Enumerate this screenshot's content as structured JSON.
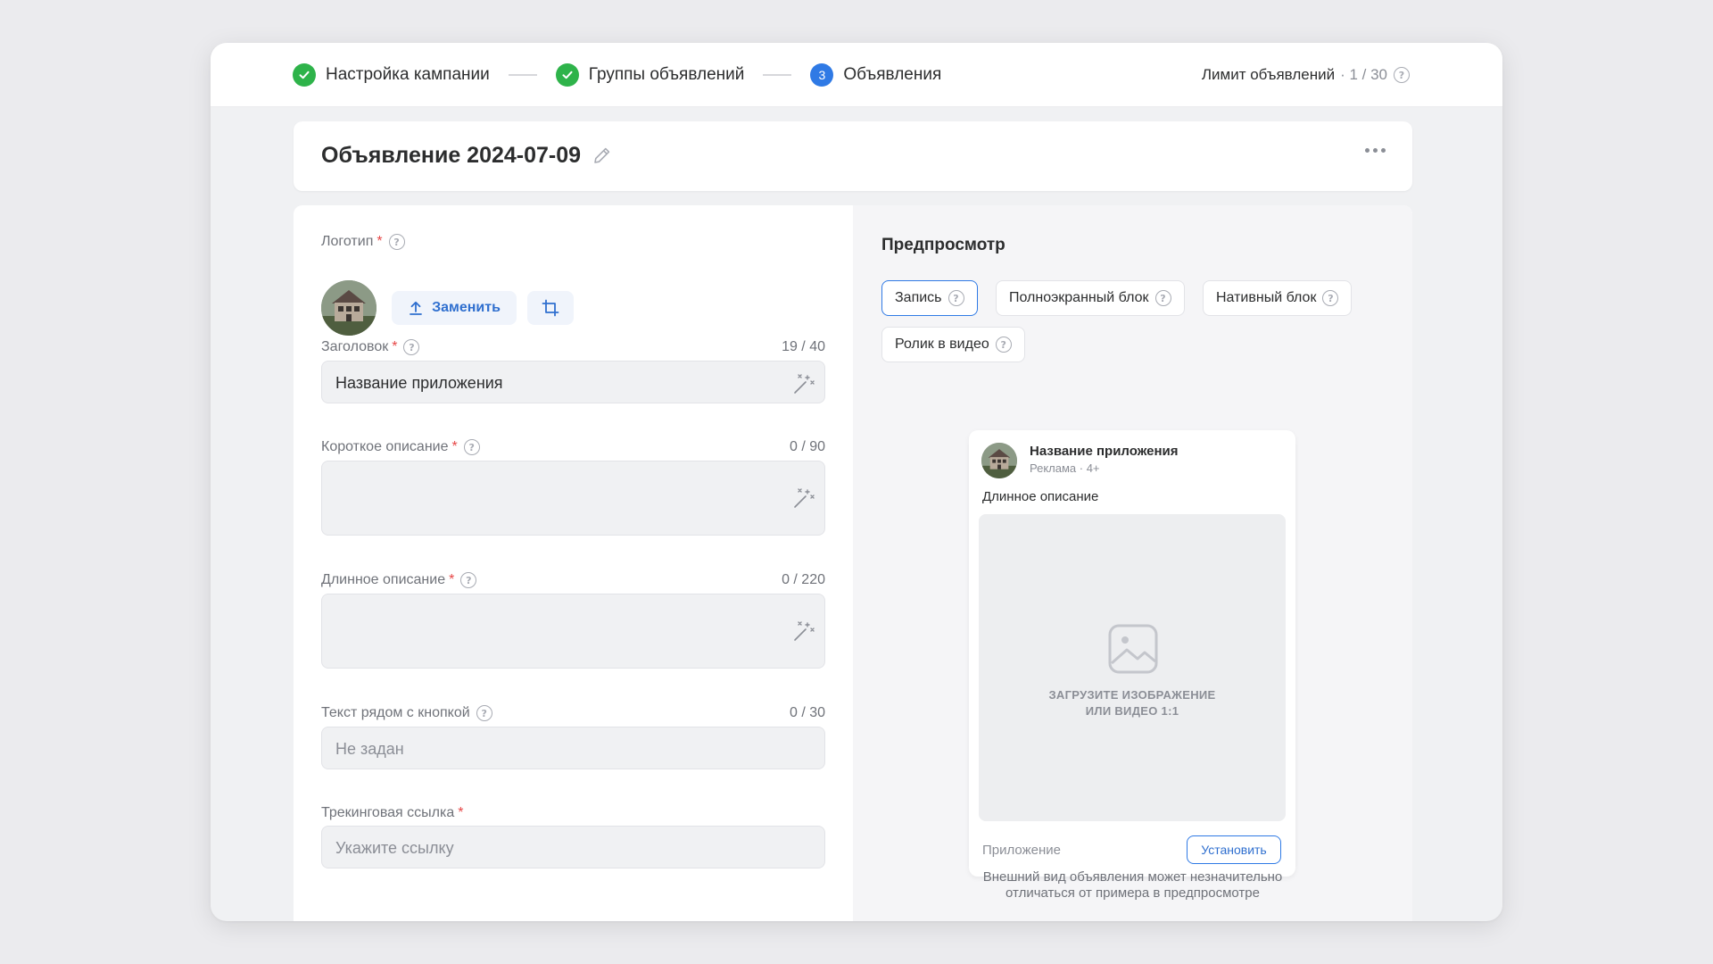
{
  "steps": [
    {
      "label": "Настройка кампании",
      "state": "done"
    },
    {
      "label": "Группы объявлений",
      "state": "done"
    },
    {
      "label": "Объявления",
      "state": "current",
      "number": "3"
    }
  ],
  "limit": {
    "label": "Лимит объявлений",
    "count": "· 1 / 30"
  },
  "ad": {
    "title": "Объявление 2024-07-09"
  },
  "form": {
    "logo": {
      "label": "Логотип",
      "required": "*",
      "replace_label": "Заменить"
    },
    "headline": {
      "label": "Заголовок",
      "required": "*",
      "counter": "19 / 40",
      "value": "Название приложения"
    },
    "short_desc": {
      "label": "Короткое описание",
      "required": "*",
      "counter": "0 / 90"
    },
    "long_desc": {
      "label": "Длинное описание",
      "required": "*",
      "counter": "0 / 220"
    },
    "button_text": {
      "label": "Текст рядом с кнопкой",
      "counter": "0 / 30",
      "placeholder": "Не задан"
    },
    "tracking": {
      "label": "Трекинговая ссылка",
      "required": "*",
      "placeholder": "Укажите ссылку"
    }
  },
  "preview": {
    "title": "Предпросмотр",
    "tabs": [
      {
        "label": "Запись",
        "active": true
      },
      {
        "label": "Полноэкранный блок",
        "active": false
      },
      {
        "label": "Нативный блок",
        "active": false
      },
      {
        "label": "Ролик в видео",
        "active": false
      }
    ],
    "card": {
      "app_name": "Название приложения",
      "meta": "Реклама · 4+",
      "description": "Длинное описание",
      "media_line1": "ЗАГРУЗИТЕ ИЗОБРАЖЕНИЕ",
      "media_line2": "ИЛИ ВИДЕО 1:1",
      "footer_label": "Приложение",
      "install_label": "Установить"
    },
    "note_line1": "Внешний вид объявления может незначительно",
    "note_line2": "отличаться от примера в предпросмотре"
  },
  "icons": {
    "step_done": "check-icon",
    "help": "question-circle-icon",
    "edit": "pencil-icon",
    "menu": "more-horizontal-icon",
    "upload": "upload-icon",
    "crop": "crop-icon",
    "magic": "magic-wand-icon",
    "media": "image-placeholder-icon"
  },
  "colors": {
    "accent": "#2f7ae5",
    "success": "#2eb34a",
    "required": "#e64646"
  }
}
